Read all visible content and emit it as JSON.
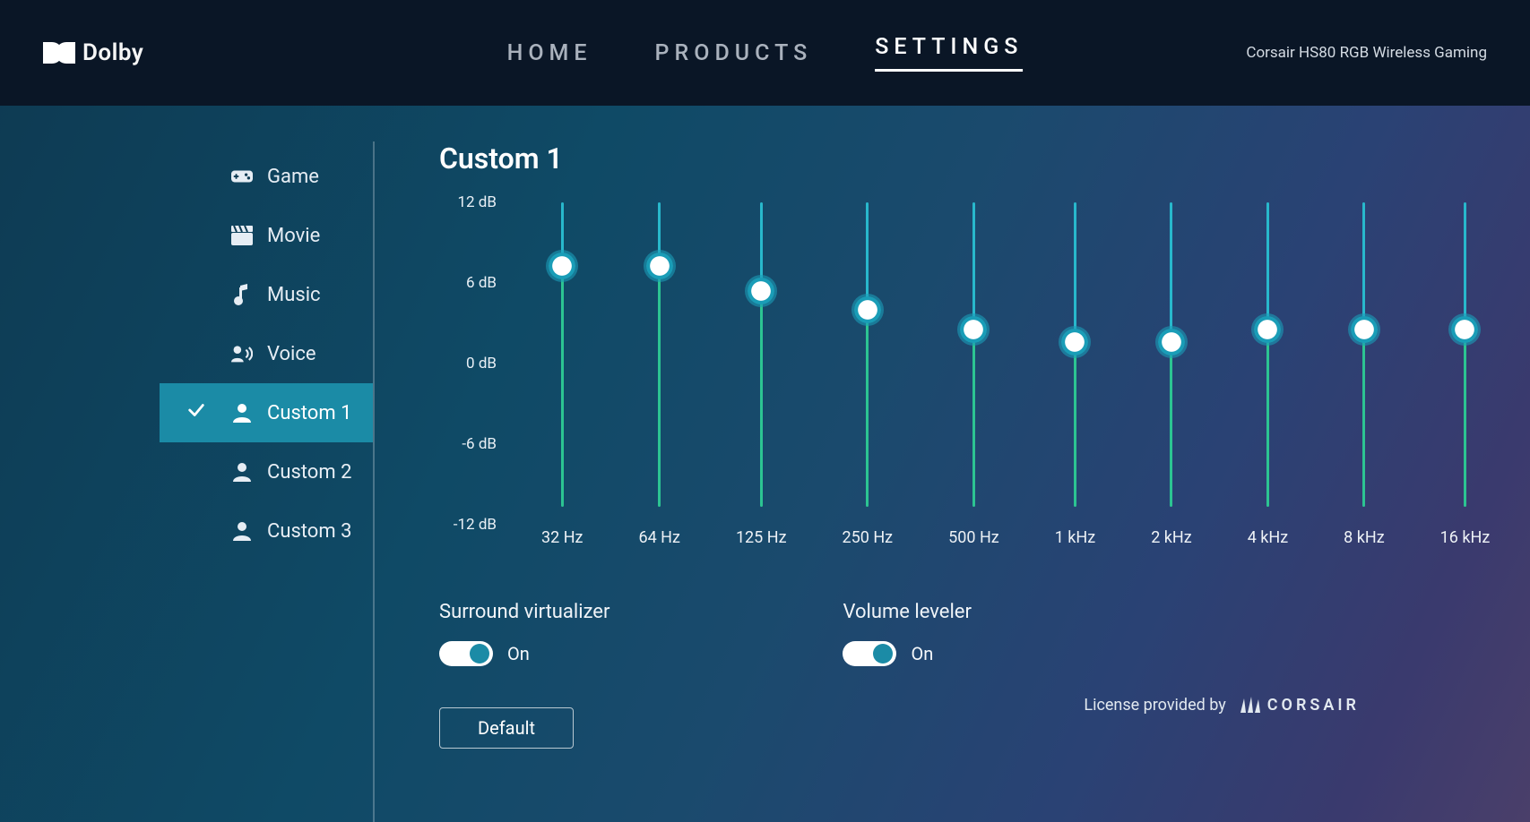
{
  "header": {
    "logo_text": "Dolby",
    "nav": [
      {
        "label": "HOME",
        "active": false
      },
      {
        "label": "PRODUCTS",
        "active": false
      },
      {
        "label": "SETTINGS",
        "active": true
      }
    ],
    "device": "Corsair HS80 RGB Wireless Gaming"
  },
  "sidebar": {
    "items": [
      {
        "label": "Game",
        "icon": "gamepad-icon",
        "selected": false
      },
      {
        "label": "Movie",
        "icon": "clapper-icon",
        "selected": false
      },
      {
        "label": "Music",
        "icon": "music-icon",
        "selected": false
      },
      {
        "label": "Voice",
        "icon": "voice-icon",
        "selected": false
      },
      {
        "label": "Custom 1",
        "icon": "person-icon",
        "selected": true
      },
      {
        "label": "Custom 2",
        "icon": "person-icon",
        "selected": false
      },
      {
        "label": "Custom 3",
        "icon": "person-icon",
        "selected": false
      }
    ]
  },
  "main": {
    "title": "Custom 1",
    "eq": {
      "y_ticks_db": [
        12,
        6,
        0,
        -6,
        -12
      ],
      "y_tick_labels": [
        "12 dB",
        "6 dB",
        "0 dB",
        "-6 dB",
        "-12 dB"
      ],
      "range_db": [
        -12,
        12
      ],
      "bands": [
        {
          "freq_label": "32 Hz",
          "value_db": 7
        },
        {
          "freq_label": "64 Hz",
          "value_db": 7
        },
        {
          "freq_label": "125 Hz",
          "value_db": 5
        },
        {
          "freq_label": "250 Hz",
          "value_db": 3.5
        },
        {
          "freq_label": "500 Hz",
          "value_db": 2
        },
        {
          "freq_label": "1 kHz",
          "value_db": 1
        },
        {
          "freq_label": "2 kHz",
          "value_db": 1
        },
        {
          "freq_label": "4 kHz",
          "value_db": 2
        },
        {
          "freq_label": "8 kHz",
          "value_db": 2
        },
        {
          "freq_label": "16 kHz",
          "value_db": 2
        }
      ]
    },
    "surround": {
      "label": "Surround virtualizer",
      "on": true,
      "state_text": "On"
    },
    "leveler": {
      "label": "Volume leveler",
      "on": true,
      "state_text": "On"
    },
    "default_button": "Default"
  },
  "footer": {
    "license_text": "License provided by",
    "provider": "CORSAIR"
  }
}
